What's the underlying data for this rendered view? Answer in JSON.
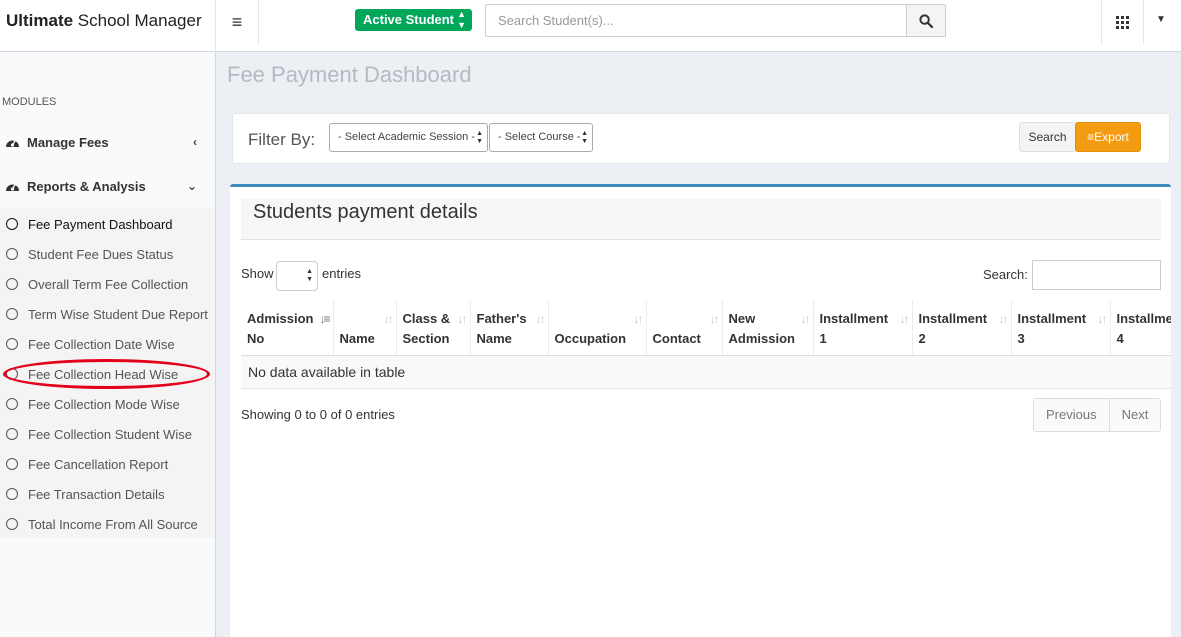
{
  "brand": {
    "bold": "Ultimate",
    "rest": " School Manager"
  },
  "topbar": {
    "status_select": "Active Student",
    "search_placeholder": "Search Student(s)..."
  },
  "sidebar": {
    "section_label": "MODULES",
    "menus": [
      {
        "label": "Manage Fees",
        "icon": "dashboard-icon",
        "chevron": "‹"
      },
      {
        "label": "Reports & Analysis",
        "icon": "dashboard-icon",
        "chevron": "⌄"
      }
    ],
    "sub_items": [
      {
        "label": "Fee Payment Dashboard",
        "active": true
      },
      {
        "label": "Student Fee Dues Status"
      },
      {
        "label": "Overall Term Fee Collection"
      },
      {
        "label": "Term Wise Student Due Report"
      },
      {
        "label": "Fee Collection Date Wise"
      },
      {
        "label": "Fee Collection Head Wise",
        "highlighted": true
      },
      {
        "label": "Fee Collection Mode Wise"
      },
      {
        "label": "Fee Collection Student Wise"
      },
      {
        "label": "Fee Cancellation Report"
      },
      {
        "label": "Fee Transaction Details"
      },
      {
        "label": "Total Income From All Source"
      }
    ]
  },
  "main": {
    "title": "Fee Payment Dashboard",
    "filter": {
      "label": "Filter By:",
      "session_select": "- Select Academic Session -",
      "course_select": "- Select Course -",
      "search_button": "Search",
      "export_button": "≡Export"
    },
    "panel": {
      "title": "Students payment details",
      "show_label": "Show",
      "entries_label": "entries",
      "search_label": "Search:",
      "columns": [
        {
          "line1": "Admission",
          "line2": "No"
        },
        {
          "line1": "",
          "line2": "Name"
        },
        {
          "line1": "Class &",
          "line2": "Section"
        },
        {
          "line1": "Father's",
          "line2": "Name"
        },
        {
          "line1": "",
          "line2": "Occupation"
        },
        {
          "line1": "",
          "line2": "Contact"
        },
        {
          "line1": "New",
          "line2": "Admission"
        },
        {
          "line1": "Installment",
          "line2": "1"
        },
        {
          "line1": "Installment",
          "line2": "2"
        },
        {
          "line1": "Installment",
          "line2": "3"
        },
        {
          "line1": "Installment",
          "line2": "4"
        }
      ],
      "empty_message": "No data available in table",
      "info": "Showing 0 to 0 of 0 entries",
      "pagination": {
        "previous": "Previous",
        "next": "Next"
      }
    }
  },
  "colors": {
    "accent_blue": "#3c8dbc",
    "success_green": "#00a65a",
    "warning_orange": "#f39c12",
    "highlight_red": "#e3001b"
  }
}
